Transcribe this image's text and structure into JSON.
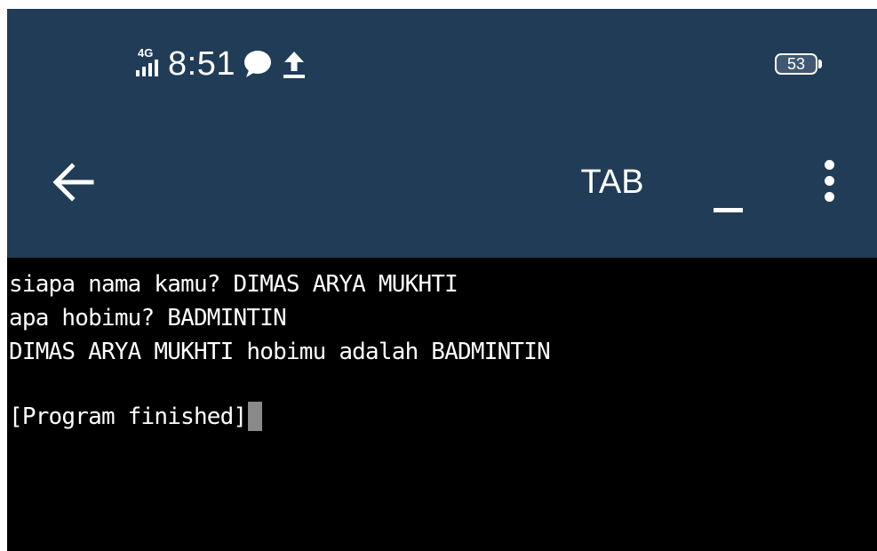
{
  "status_bar": {
    "network": "4G",
    "time": "8:51",
    "battery": "53",
    "icons": [
      "signal-icon",
      "chat-bubble-icon",
      "upload-icon",
      "battery-icon"
    ]
  },
  "action_bar": {
    "back_icon": "arrow-left-icon",
    "tab_label": "TAB",
    "underscore_label": "_",
    "more_icon": "more-vertical-icon"
  },
  "terminal": {
    "lines": [
      "siapa nama kamu? DIMAS ARYA MUKHTI",
      "apa hobimu? BADMINTIN",
      "DIMAS ARYA MUKHTI hobimu adalah BADMINTIN",
      "",
      "[Program finished]"
    ]
  },
  "colors": {
    "header": "#203c57",
    "terminal_bg": "#000000",
    "terminal_fg": "#ffffff",
    "cursor": "#8a8a8a"
  }
}
